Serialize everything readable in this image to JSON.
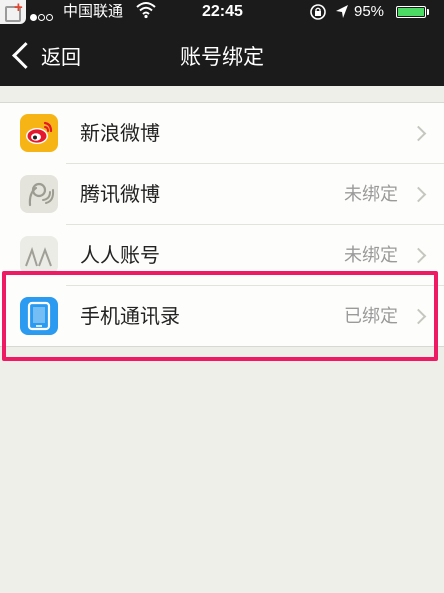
{
  "status_bar": {
    "carrier": "中国联通",
    "time": "22:45",
    "battery": "95%"
  },
  "nav": {
    "back_label": "返回",
    "title": "账号绑定"
  },
  "accounts": [
    {
      "label": "新浪微博",
      "status": "",
      "icon": "sina-weibo-icon",
      "color": "#f7b515"
    },
    {
      "label": "腾讯微博",
      "status": "未绑定",
      "icon": "tencent-weibo-icon",
      "color": "#e4e4dc"
    },
    {
      "label": "人人账号",
      "status": "未绑定",
      "icon": "renren-icon",
      "color": "#ecece6"
    },
    {
      "label": "手机通讯录",
      "status": "已绑定",
      "icon": "phone-contacts-icon",
      "color": "#2a9bf0"
    }
  ],
  "highlight_color": "#ee1a63"
}
